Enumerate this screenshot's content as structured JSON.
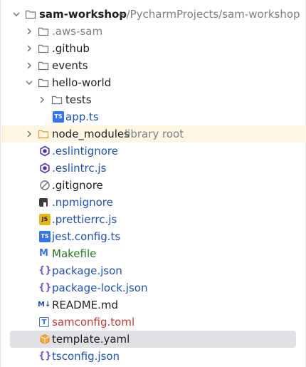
{
  "project": {
    "name": "sam-workshop",
    "path": "~/PycharmProjects/sam-workshop"
  },
  "items": [
    {
      "label": ".aws-sam"
    },
    {
      "label": ".github"
    },
    {
      "label": "events"
    },
    {
      "label": "hello-world"
    },
    {
      "label": "tests"
    },
    {
      "label": "app.ts",
      "icon_text": "TS"
    },
    {
      "label": "node_modules",
      "suffix": "library root"
    },
    {
      "label": ".eslintignore"
    },
    {
      "label": ".eslintrc.js"
    },
    {
      "label": ".gitignore"
    },
    {
      "label": ".npmignore"
    },
    {
      "label": ".prettierrc.js",
      "icon_text": "JS"
    },
    {
      "label": "jest.config.ts",
      "icon_text": "TS"
    },
    {
      "label": "Makefile",
      "icon_text": "M"
    },
    {
      "label": "package.json",
      "icon_text": "{}"
    },
    {
      "label": "package-lock.json",
      "icon_text": "{}"
    },
    {
      "label": "README.md",
      "icon_text": "M↓"
    },
    {
      "label": "samconfig.toml",
      "icon_text": "T"
    },
    {
      "label": "template.yaml"
    },
    {
      "label": "tsconfig.json",
      "icon_text": "{}"
    }
  ],
  "colors": {
    "folder_stroke": "#6c707e",
    "module_folder": "#e39a2c",
    "eslint": "#4b32c3",
    "vcs_added": "#1d4fbf",
    "selection": "#dfe1e5"
  }
}
